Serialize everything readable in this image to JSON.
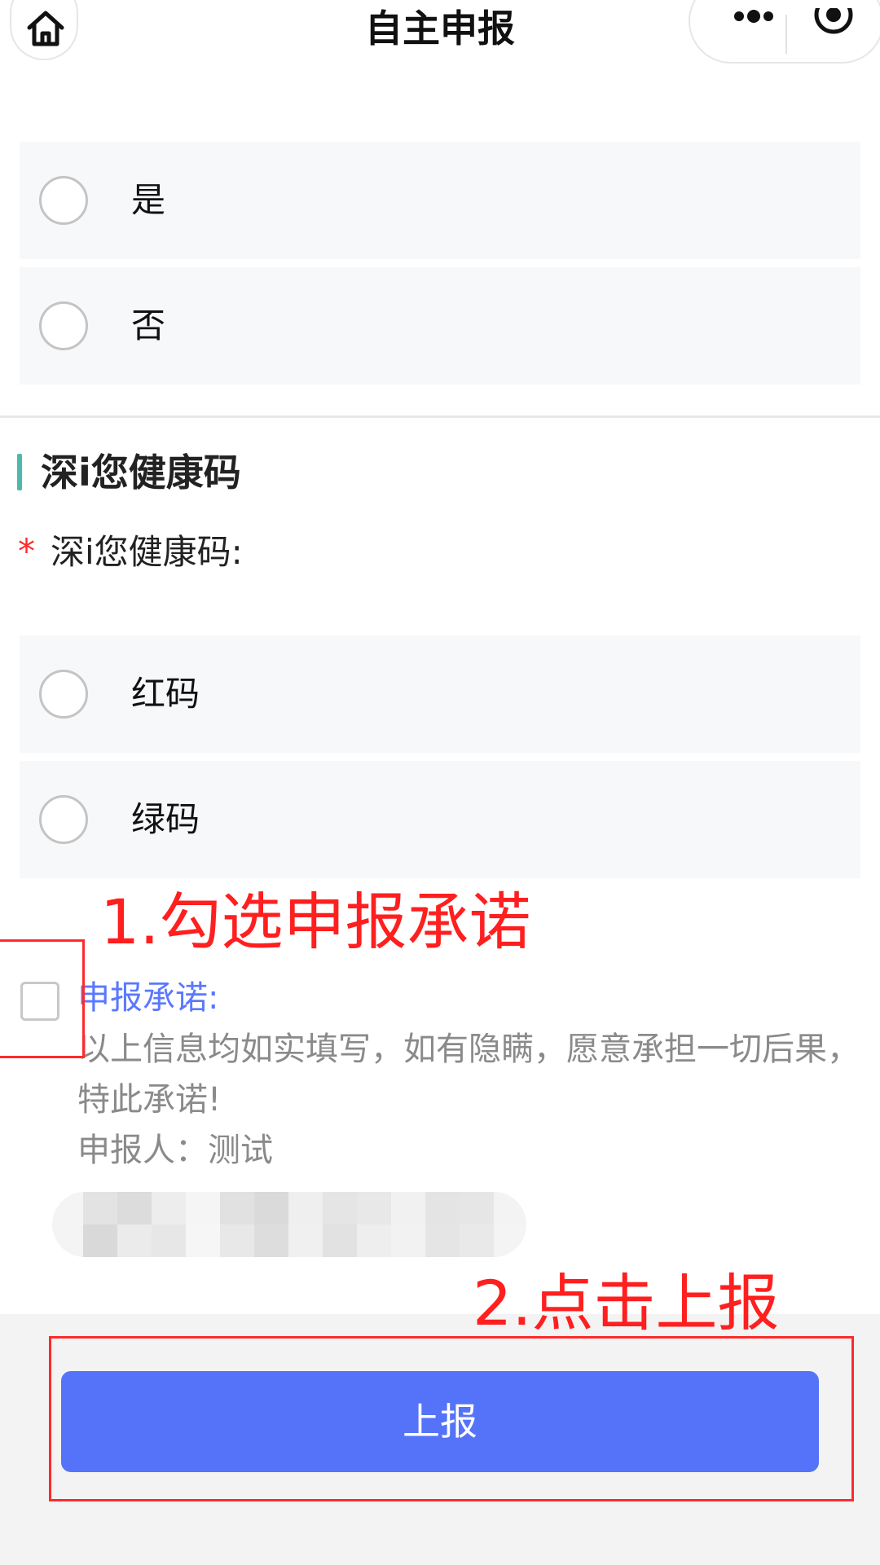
{
  "nav": {
    "title": "自主申报",
    "home_icon": "home-icon",
    "more_icon": "more-icon",
    "close_icon": "target-icon"
  },
  "question_options": [
    {
      "label": "是"
    },
    {
      "label": "否"
    }
  ],
  "health_code": {
    "section_title": "深i您健康码",
    "required_mark": "*",
    "field_label": "深i您健康码:",
    "options": [
      {
        "label": "红码"
      },
      {
        "label": "绿码"
      }
    ]
  },
  "pledge": {
    "title": "申报承诺:",
    "text": "以上信息均如实填写，如有隐瞒，愿意承担一切后果，特此承诺!",
    "signer": "申报人：测试",
    "checked": false
  },
  "submit": {
    "label": "上报"
  },
  "annotations": {
    "step1": "1.勾选申报承诺",
    "step2": "2.点击上报"
  },
  "colors": {
    "accent": "#5573f9",
    "pledge_title": "#5a78ff",
    "section_bar": "#4fb7ac",
    "required": "#ff2b2b",
    "annotation": "#ff1f1f"
  }
}
